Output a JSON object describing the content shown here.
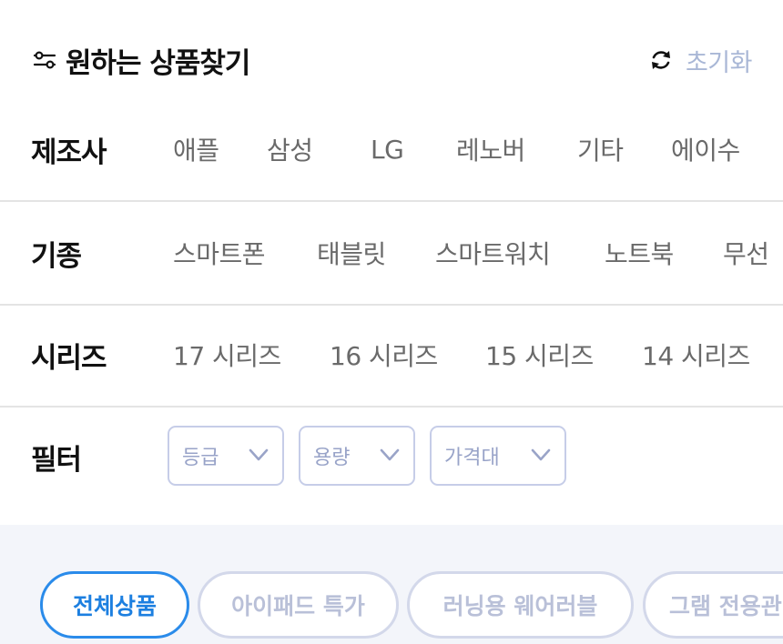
{
  "header": {
    "title": "원하는 상품찾기",
    "reset_label": "초기화",
    "icons": {
      "title": "filter-sliders-icon",
      "reset": "refresh-icon"
    }
  },
  "rows": {
    "manufacturer": {
      "label": "제조사",
      "options": [
        "애플",
        "삼성",
        "LG",
        "레노버",
        "기타",
        "에이수"
      ]
    },
    "device_type": {
      "label": "기종",
      "options": [
        "스마트폰",
        "태블릿",
        "스마트워치",
        "노트북",
        "무선"
      ]
    },
    "series": {
      "label": "시리즈",
      "options": [
        "17 시리즈",
        "16 시리즈",
        "15 시리즈",
        "14 시리즈"
      ]
    },
    "filter": {
      "label": "필터",
      "dropdowns": [
        "등급",
        "용량",
        "가격대"
      ]
    }
  },
  "categories": {
    "pills": [
      "전체상품",
      "아이패드 특가",
      "러닝용 웨어러블",
      "그램 전용관"
    ],
    "active_index": 0
  },
  "colors": {
    "accent": "#2a8bea",
    "muted_blue": "#a9b7d6",
    "band": "#f3f5fa"
  }
}
